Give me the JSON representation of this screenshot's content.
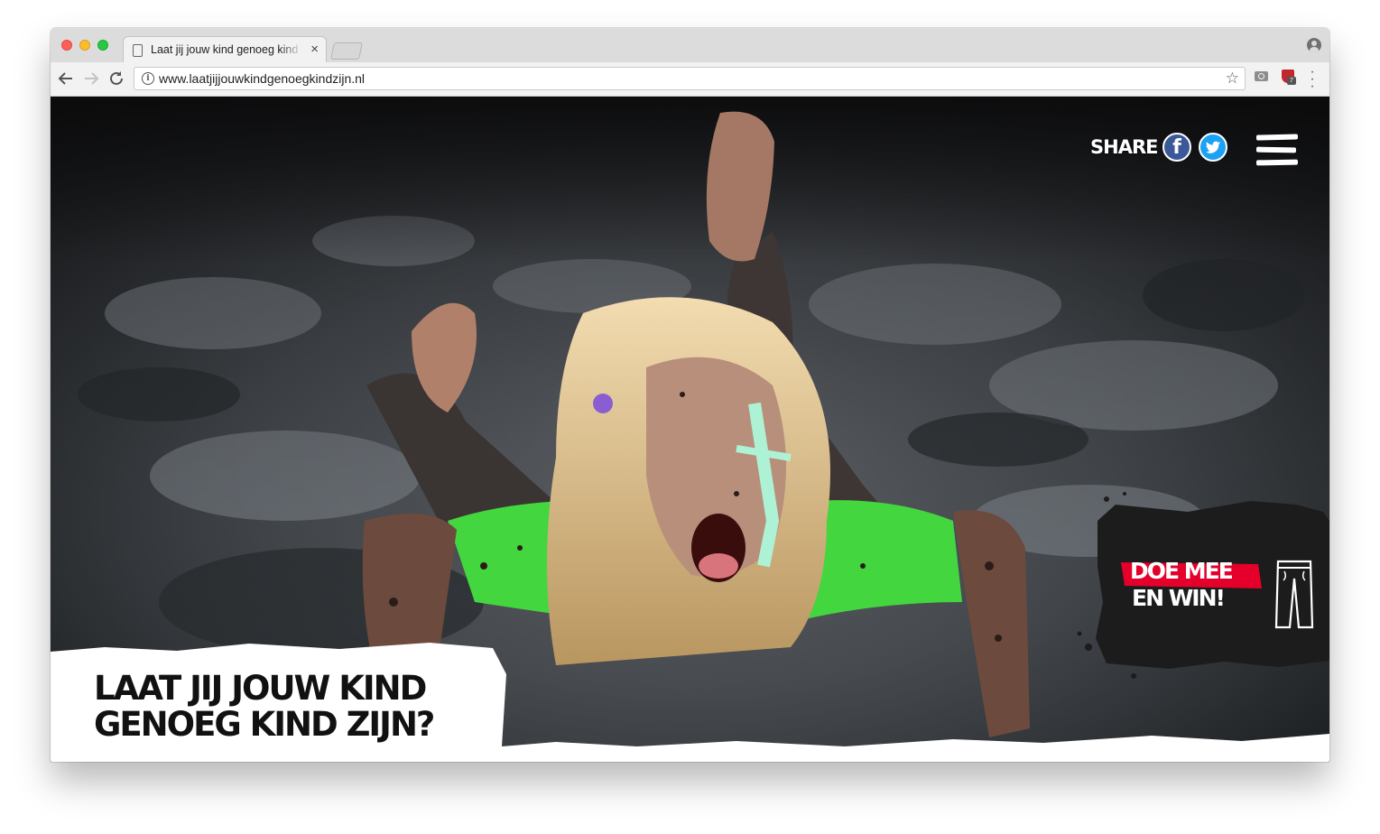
{
  "browser": {
    "tab_title": "Laat jij jouw kind genoeg kind zijn?",
    "tab_close": "×",
    "url": "www.laatjijjouwkindgenoegkindzijn.nl",
    "extension_badge": "7"
  },
  "page": {
    "share_label": "SHARE",
    "facebook_glyph": "f",
    "headline_line1": "LAAT JIJ JOUW KIND",
    "headline_line2": "GENOEG KIND ZIJN?",
    "cta_line1": "DOE MEE",
    "cta_line2": "EN WIN!",
    "colors": {
      "cta_red": "#e4002b",
      "facebook_blue": "#3b5998",
      "twitter_blue": "#1da1f2",
      "shirt_green": "#3fd43f"
    },
    "icons": [
      "share-facebook-icon",
      "share-twitter-icon",
      "menu-icon",
      "jeans-icon"
    ]
  }
}
